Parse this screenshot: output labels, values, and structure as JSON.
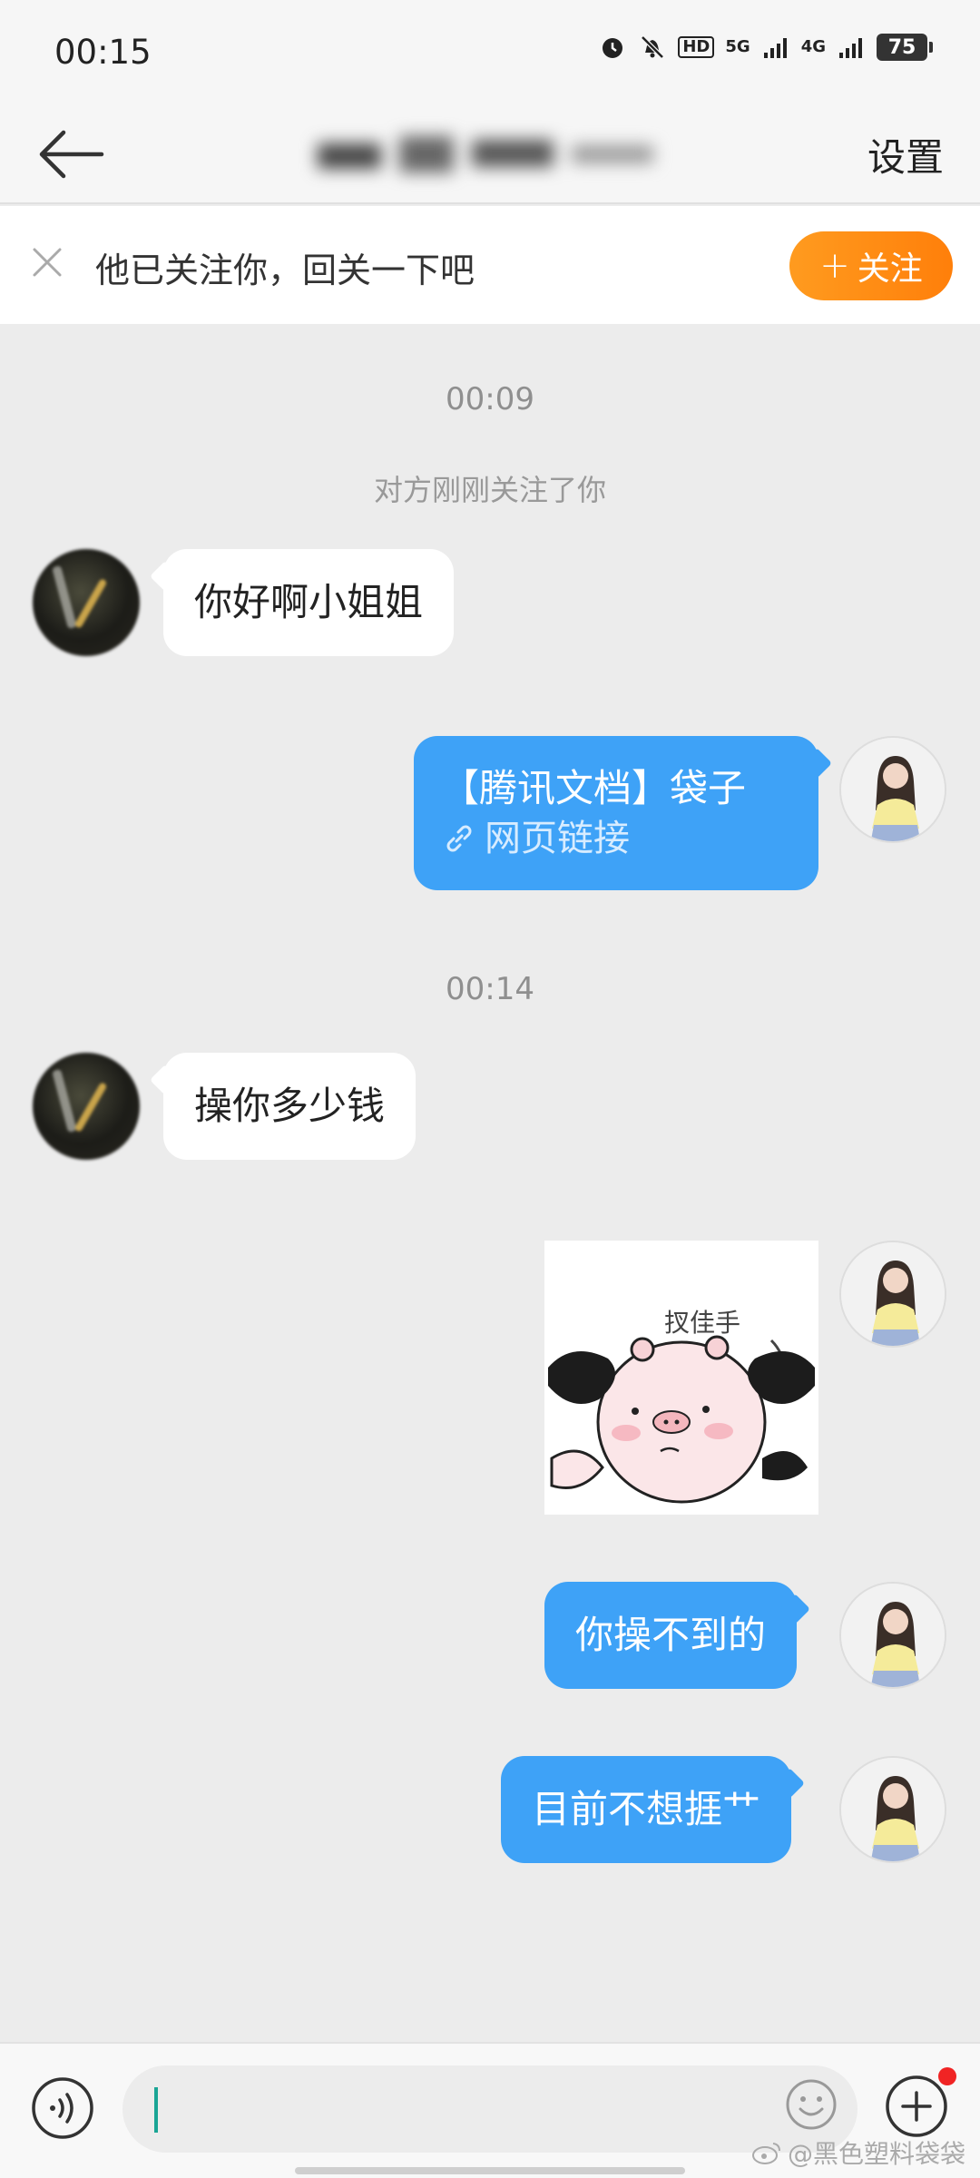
{
  "status_bar": {
    "time": "00:15",
    "net_hd": "HD",
    "net_5g": "5G",
    "net_4g": "4G",
    "battery": "75",
    "icons": [
      "alarm-icon",
      "mute-bell-icon",
      "signal-icon",
      "battery-icon"
    ]
  },
  "header": {
    "title": "",
    "settings_label": "设置"
  },
  "follow_banner": {
    "text": "他已关注你，回关一下吧",
    "follow_button_label": "关注",
    "follow_button_plus": "+"
  },
  "chat": {
    "time_1": "00:09",
    "system_message": "对方刚刚关注了你",
    "msg_1": "你好啊小姐姐",
    "link_card": {
      "title": "【腾讯文档】袋子",
      "link_label": "网页链接"
    },
    "time_2": "00:14",
    "msg_2": "操你多少钱",
    "sticker_caption": "扠佳手",
    "msg_3": "你操不到的",
    "msg_4": "目前不想捱艹"
  },
  "input_bar": {
    "placeholder": ""
  },
  "watermark": "@黑色塑料袋袋",
  "colors": {
    "accent_blue": "#3ea2f7",
    "follow_orange": "#ff8c14",
    "background": "#ececec"
  }
}
